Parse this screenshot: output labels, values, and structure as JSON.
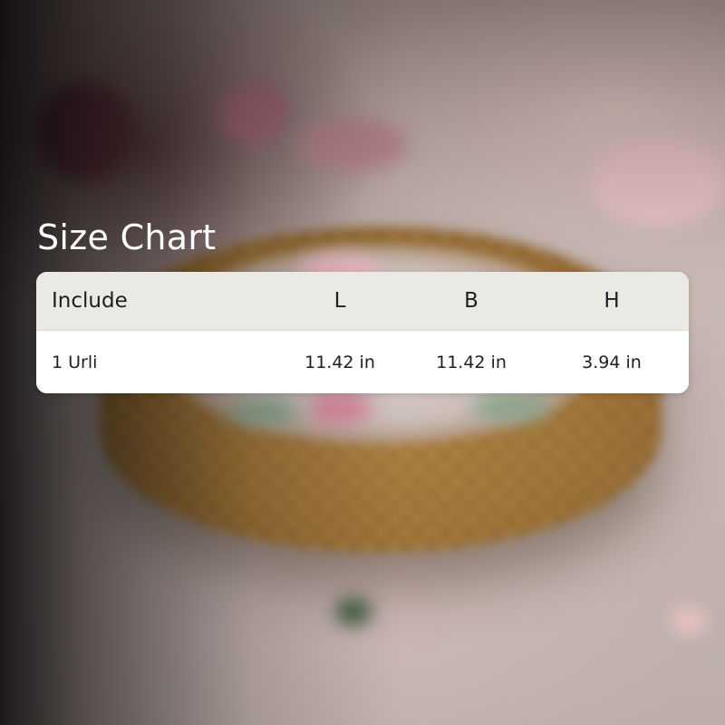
{
  "title": "Size Chart",
  "table": {
    "headers": [
      "Include",
      "L",
      "B",
      "H"
    ],
    "rows": [
      [
        "1 Urli",
        "11.42 in",
        "11.42 in",
        "3.94 in"
      ]
    ]
  }
}
